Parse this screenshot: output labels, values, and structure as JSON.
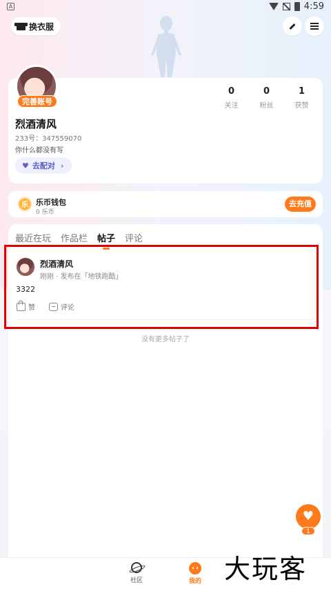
{
  "status_bar": {
    "time": "4:59",
    "left_glyph": "A"
  },
  "header": {
    "dress_label": "换衣服"
  },
  "profile": {
    "complete_badge": "完善账号",
    "stats": [
      {
        "value": "0",
        "label": "关注"
      },
      {
        "value": "0",
        "label": "粉丝"
      },
      {
        "value": "1",
        "label": "获赞"
      }
    ],
    "username": "烈酒清风",
    "uid": "233号：347559070",
    "bio": "你什么都没有写",
    "match_label": "去配对"
  },
  "wallet": {
    "title": "乐币钱包",
    "balance": "0 乐币",
    "coin_glyph": "乐",
    "recharge_label": "去充值"
  },
  "tabs": [
    {
      "label": "最近在玩"
    },
    {
      "label": "作品栏"
    },
    {
      "label": "帖子"
    },
    {
      "label": "评论"
    }
  ],
  "post": {
    "author": "烈酒清风",
    "meta": "刚刚 · 发布在「地铁跑酷」",
    "body": "3322",
    "like_label": "赞",
    "comment_label": "评论"
  },
  "no_more": "没有更多帖子了",
  "float": {
    "count": "1"
  },
  "bottom_nav": {
    "community": "社区",
    "mine": "我的"
  },
  "watermark": "大玩客",
  "colors": {
    "accent": "#ff7a1a",
    "highlight": "#e00000",
    "match": "#5b5fc7"
  }
}
